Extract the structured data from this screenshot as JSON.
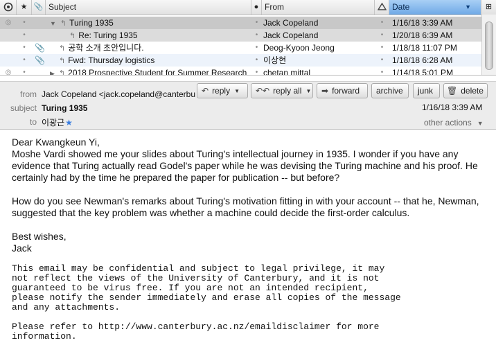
{
  "list": {
    "columns": {
      "thread": "thread-icon",
      "star": "star-icon",
      "attach": "paperclip-icon",
      "subject": "Subject",
      "read": "read-status-icon",
      "from": "From",
      "junk": "junk-icon",
      "date": "Date",
      "picker": "column-picker-icon"
    },
    "rows": [
      {
        "subject": "Turing 1935",
        "from": "Jack Copeland",
        "date": "1/16/18 3:39 AM"
      },
      {
        "subject": "Re: Turing 1935",
        "from": "Jack Copeland",
        "date": "1/20/18 6:39 AM"
      },
      {
        "subject": "공학 소개 초안입니다.",
        "from": "Deog-Kyoon Jeong",
        "date": "1/18/18 11:07 PM"
      },
      {
        "subject": "Fwd: Thursday logistics",
        "from": "이상현",
        "date": "1/18/18 6:28 AM"
      },
      {
        "subject": "2018 Prospective Student for Summer Research",
        "from": "chetan mittal",
        "date": "1/14/18 5:01 PM"
      }
    ]
  },
  "header": {
    "from_label": "from",
    "from_value": "Jack Copeland <jack.copeland@canterbury.ac.nz>",
    "subject_label": "subject",
    "subject_value": "Turing 1935",
    "to_label": "to",
    "to_value": "이광근",
    "date": "1/16/18 3:39 AM",
    "other_actions": "other actions",
    "buttons": {
      "reply": "reply",
      "reply_all": "reply all",
      "forward": "forward",
      "archive": "archive",
      "junk": "junk",
      "delete": "delete"
    }
  },
  "body": {
    "greeting": "Dear Kwangkeun Yi,",
    "para1": "Moshe Vardi showed me your slides about Turing's intellectual journey in 1935. I wonder if you have any evidence that Turing actually read Godel's paper while he was devising the Turing machine and his proof. He certainly had by the time he prepared the paper for publication -- but before?",
    "para2": "How do you see Newman's remarks about Turing's motivation fitting in with your account -- that he, Newman, suggested that the key problem was whether a machine could decide the first-order calculus.",
    "closing1": "Best wishes,",
    "closing2": "Jack",
    "disclaimer": "This email may be confidential and subject to legal privilege, it may\nnot reflect the views of the University of Canterbury, and it is not\nguaranteed to be virus free. If you are not an intended recipient,\nplease notify the sender immediately and erase all copies of the message\nand any attachments.",
    "refer": "Please refer to http://www.canterbury.ac.nz/emaildisclaimer for more\ninformation."
  },
  "colors": {
    "selected_row": "#c8c8c8",
    "alt_row": "#edf3fb",
    "date_header": "#7fb3ea"
  }
}
